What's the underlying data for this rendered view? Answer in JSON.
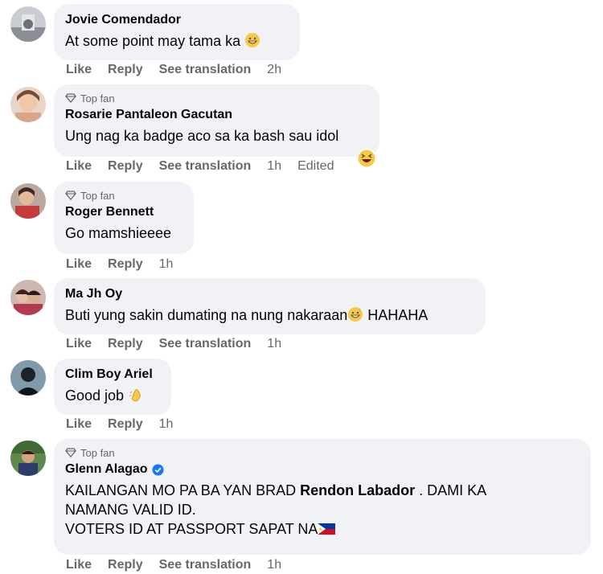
{
  "actions": {
    "like": "Like",
    "reply": "Reply",
    "see_translation": "See translation"
  },
  "top_fan_label": "Top fan",
  "comments": [
    {
      "name": "Jovie Comendador",
      "text": "At some point may tama ka",
      "time": "2h",
      "top_fan": false
    },
    {
      "name": "Rosarie Pantaleon Gacutan",
      "text": "Ung nag ka badge aco sa ka bash sau idol",
      "time": "1h",
      "edited": "Edited",
      "top_fan": true
    },
    {
      "name": "Roger Bennett",
      "text": "Go mamshieeee",
      "time": "1h",
      "top_fan": true
    },
    {
      "name": "Ma Jh Oy",
      "text": "Buti yung sakin dumating na nung nakaraan",
      "text_after": " HAHAHA",
      "time": "1h",
      "top_fan": false
    },
    {
      "name": "Clim Boy Ariel",
      "text": "Good job",
      "time": "1h",
      "top_fan": false
    },
    {
      "name": "Glenn Alagao",
      "verified": true,
      "top_fan": true,
      "line1_a": "KAILANGAN MO PA BA YAN BRAD ",
      "mention": "Rendon Labador",
      "line1_b": " . DAMI KA",
      "line2": "NAMANG VALID ID.",
      "line3": "VOTERS ID AT PASSPORT SAPAT NA",
      "time": "1h"
    }
  ]
}
